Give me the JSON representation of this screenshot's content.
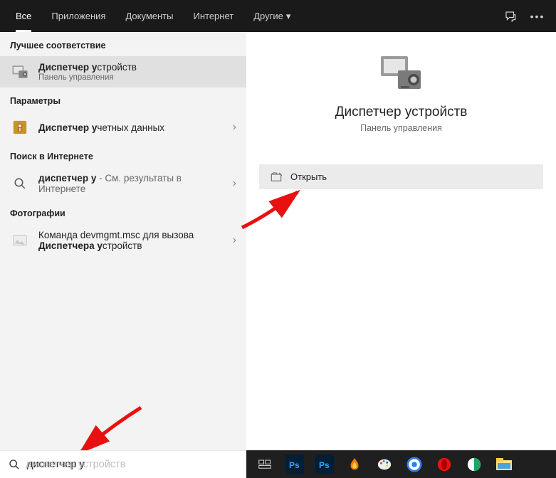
{
  "header": {
    "tabs": [
      {
        "label": "Все",
        "active": true
      },
      {
        "label": "Приложения",
        "active": false
      },
      {
        "label": "Документы",
        "active": false
      },
      {
        "label": "Интернет",
        "active": false
      },
      {
        "label": "Другие",
        "active": false,
        "dropdown": true
      }
    ]
  },
  "left": {
    "best_match_label": "Лучшее соответствие",
    "best_match": {
      "title_prefix": "Диспетчер у",
      "title_suffix": "стройств",
      "subtitle": "Панель управления"
    },
    "settings_label": "Параметры",
    "settings": {
      "title_prefix": "Диспетчер у",
      "title_suffix": "четных данных"
    },
    "web_label": "Поиск в Интернете",
    "web": {
      "title_prefix": "диспетчер у",
      "title_suffix": " - См. результаты в Интернете"
    },
    "photos_label": "Фотографии",
    "photo": {
      "line1": "Команда devmgmt.msc для вызова ",
      "line2_prefix": "Диспетчера у",
      "line2_suffix": "стройств"
    }
  },
  "preview": {
    "title": "Диспетчер устройств",
    "subtitle": "Панель управления",
    "action": "Открыть"
  },
  "search": {
    "value": "диспетчер у",
    "ghost": "диспетчер устройств"
  },
  "taskbar_icons": [
    "task-view",
    "photoshop",
    "photoshop-cc",
    "burner",
    "paint",
    "browser",
    "opera",
    "browser2",
    "explorer"
  ]
}
